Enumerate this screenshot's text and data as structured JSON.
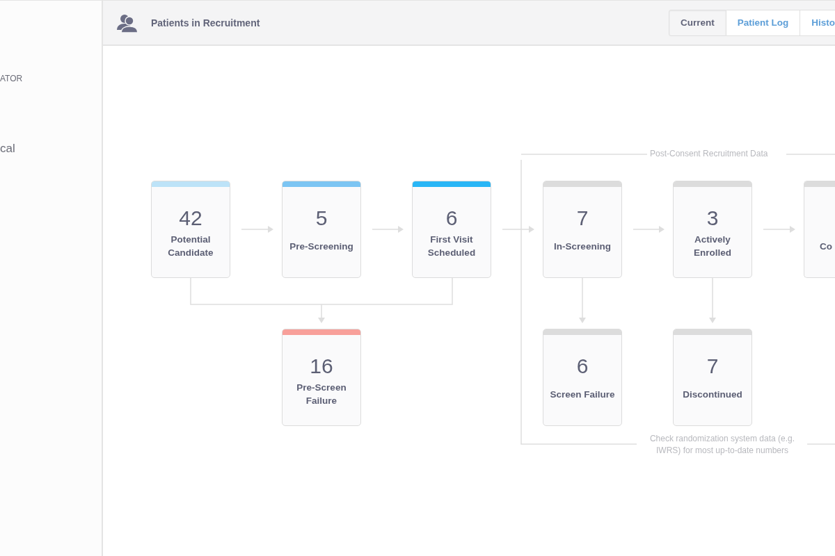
{
  "sidebar": {
    "items": [
      {
        "label": "ATOR",
        "kind": "heading"
      },
      {
        "label": "cal",
        "kind": "link"
      }
    ]
  },
  "header": {
    "title": "Patients in Recruitment"
  },
  "tabs": [
    {
      "label": "Current",
      "selected": true
    },
    {
      "label": "Patient Log",
      "selected": false
    },
    {
      "label": "Histo",
      "selected": false
    }
  ],
  "stages": [
    {
      "count": "42",
      "label": "Potential\nCandidate",
      "color": "#bde3f8"
    },
    {
      "count": "5",
      "label": "Pre-Screening",
      "color": "#7cc5f3"
    },
    {
      "count": "6",
      "label": "First Visit\nScheduled",
      "color": "#29b6f6"
    },
    {
      "count": "7",
      "label": "In-Screening",
      "color": "#dcdcdc"
    },
    {
      "count": "3",
      "label": "Actively\nEnrolled",
      "color": "#dcdcdc"
    },
    {
      "label": "Co",
      "color": "#dcdcdc"
    },
    {
      "count": "16",
      "label": "Pre-Screen\nFailure",
      "color": "#f8a09a"
    },
    {
      "count": "6",
      "label": "Screen Failure",
      "color": "#dcdcdc"
    },
    {
      "count": "7",
      "label": "Discontinued",
      "color": "#dcdcdc"
    }
  ],
  "post_consent": {
    "title": "Post-Consent Recruitment Data",
    "note": "Check randomization system data (e.g.\nIWRS) for most up-to-date numbers"
  }
}
